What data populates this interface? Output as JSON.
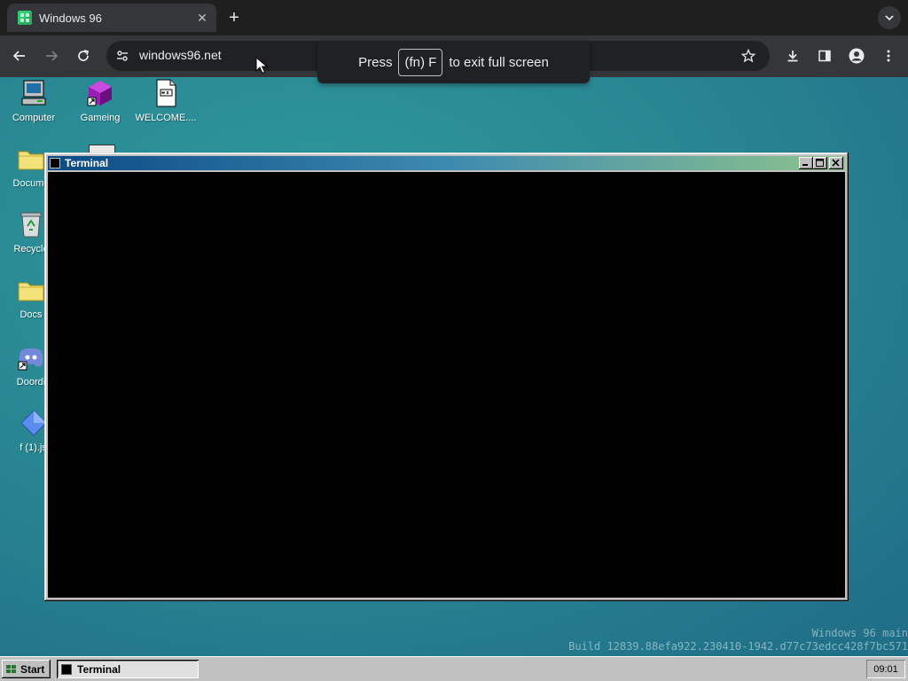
{
  "browser": {
    "tab_title": "Windows 96",
    "tab_close": "✕",
    "new_tab": "+",
    "url": "windows96.net",
    "fullscreen_toast": {
      "press": "Press",
      "key": "(fn) F",
      "suffix": "to exit full screen"
    }
  },
  "desktop": {
    "icons": [
      {
        "label": "Computer"
      },
      {
        "label": "Gameing"
      },
      {
        "label": "WELCOME...."
      },
      {
        "label": "Docume"
      },
      {
        "label": "Recycle"
      },
      {
        "label": "Docs"
      },
      {
        "label": "Doordi"
      },
      {
        "label": "f (1).js"
      }
    ],
    "watermark_line1": "Windows 96 main",
    "watermark_line2": "Build 12839.88efa922.230410-1942.d77c73edcc428f7bc571"
  },
  "window": {
    "title": "Terminal"
  },
  "taskbar": {
    "start_label": "Start",
    "task_label": "Terminal",
    "clock": "09:01"
  },
  "colors": {
    "titlebar_start": "#0b4a85",
    "titlebar_end": "#8dc38c",
    "desktop": "#2a8a94",
    "terminal_bg": "#000000"
  }
}
